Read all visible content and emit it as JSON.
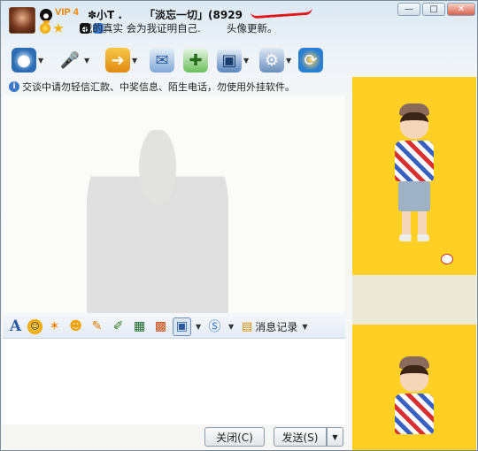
{
  "header": {
    "vip": "VIP 4",
    "nickname": "✽小T .      「淡忘一切」(8929",
    "signature": "我的真实 会为我证明自己.        头像更新。",
    "window_buttons": [
      "—",
      "□",
      "✕"
    ]
  },
  "toolbar": {
    "icons": [
      "video-call",
      "voice-call",
      "send-file",
      "send-sms",
      "create-group",
      "remote-assist",
      "app-settings",
      "more-apps"
    ]
  },
  "notice": {
    "text": "交谈中请勿轻信汇款、中奖信息、陌生电话，勿使用外挂软件。"
  },
  "format_bar": {
    "icons": [
      "font-icon",
      "emoticon-icon",
      "magic-emoticon-icon",
      "wink-icon",
      "shake-window-icon",
      "handwriting-icon",
      "send-image-icon",
      "gift-icon",
      "screenshot-icon",
      "music-icon"
    ],
    "message_history_label": "消息记录"
  },
  "buttons": {
    "close_label": "关闭(C)",
    "send_label": "发送(S)"
  },
  "colors": {
    "side_background": "#ffd023",
    "accent": "#f08000"
  }
}
